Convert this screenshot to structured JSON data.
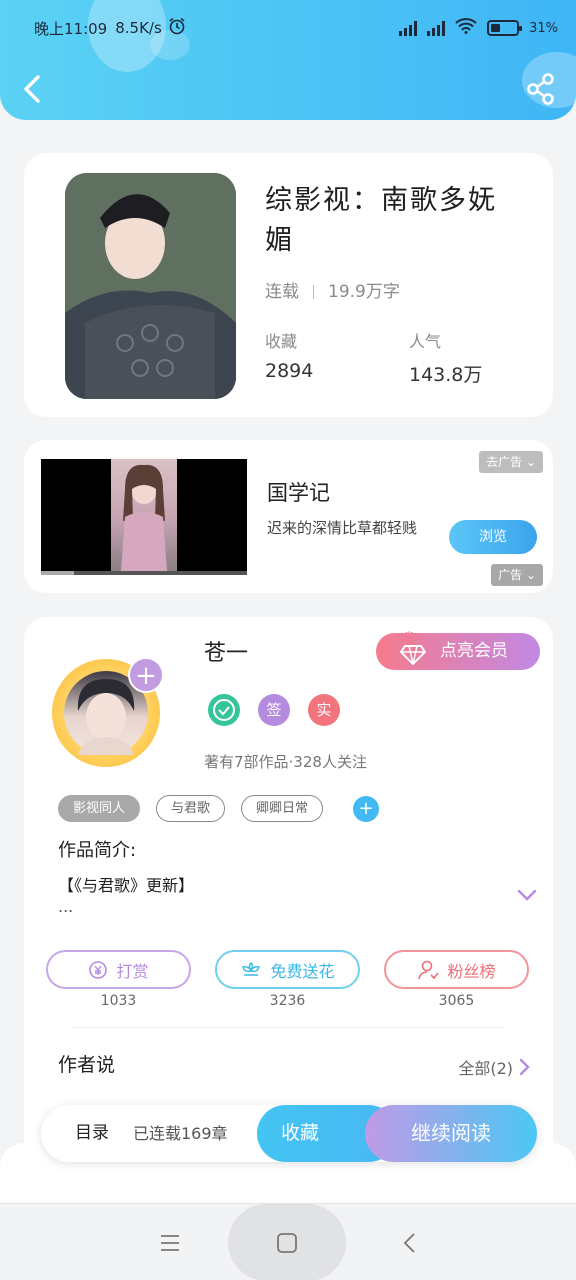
{
  "status_bar": {
    "time": "晚上11:09",
    "speed": "8.5K/s",
    "battery": "31%"
  },
  "book": {
    "title": "综影视：南歌多妩媚",
    "status": "连载",
    "word_count": "19.9万字",
    "favorites_label": "收藏",
    "favorites_value": "2894",
    "popularity_label": "人气",
    "popularity_value": "143.8万"
  },
  "ad": {
    "title": "国学记",
    "description": "迟来的深情比草都轻贱",
    "cta": "浏览",
    "close_label": "去广告",
    "ad_label": "广告"
  },
  "author": {
    "name": "苍一",
    "vip_button": "点亮会员",
    "badges": [
      "签",
      "实"
    ],
    "meta": "著有7部作品·328人关注",
    "tags": [
      "影视同人",
      "与君歌",
      "卿卿日常"
    ],
    "intro_label": "作品简介:",
    "intro_text": "【《与君歌》更新】",
    "intro_more": "...",
    "actions": [
      {
        "label": "打赏",
        "count": "1033"
      },
      {
        "label": "免费送花",
        "count": "3236"
      },
      {
        "label": "粉丝榜",
        "count": "3065"
      }
    ],
    "say_title": "作者说",
    "say_all": "全部(2)"
  },
  "bottom_bar": {
    "toc": "目录",
    "chapters": "已连载169章",
    "favorite": "收藏",
    "continue": "继续阅读"
  },
  "colors": {
    "header": "#3fb6f5",
    "accent_purple": "#c39be0",
    "accent_pink": "#f67b8c",
    "accent_blue": "#44c4f2"
  }
}
